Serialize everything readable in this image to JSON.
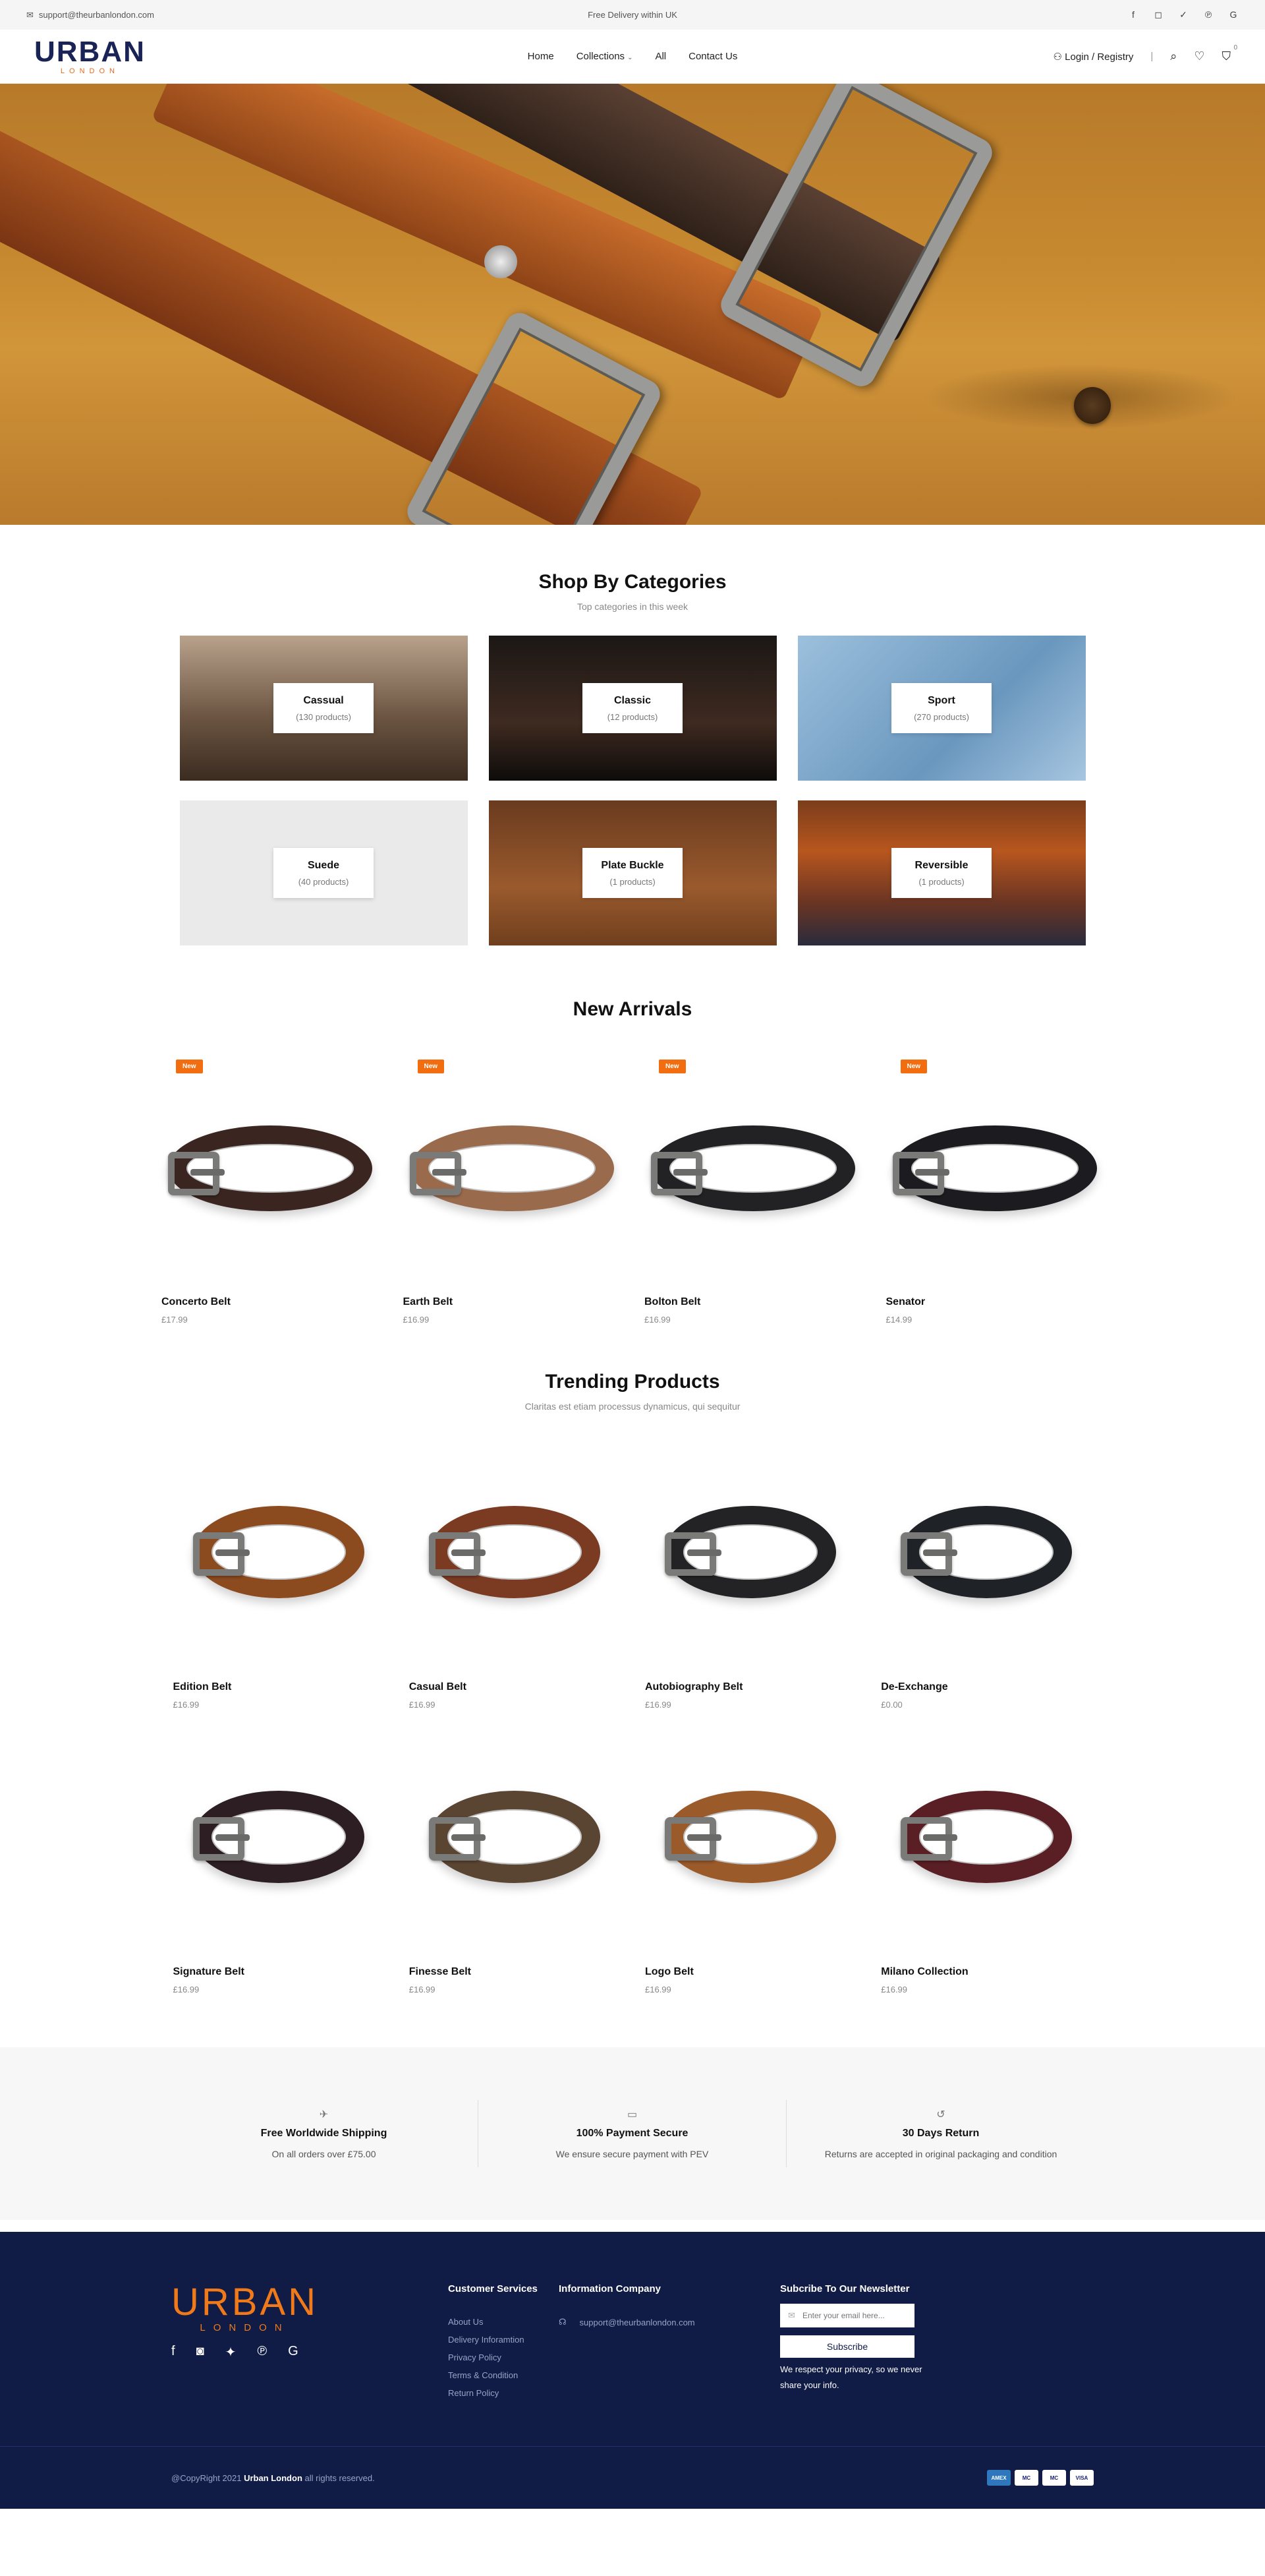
{
  "topbar": {
    "email": "support@theurbanlondon.com",
    "delivery": "Free Delivery within UK",
    "socials": [
      "facebook-icon",
      "instagram-icon",
      "twitter-icon",
      "pinterest-icon",
      "google-icon"
    ]
  },
  "header": {
    "logo_word": "URBAN",
    "logo_sub": "LONDON",
    "nav": [
      "Home",
      "Collections",
      "All",
      "Contact Us"
    ],
    "login": "Login / Registry",
    "cart_count": "0"
  },
  "categories": {
    "title": "Shop By Categories",
    "subtitle": "Top categories in this week",
    "items": [
      {
        "name": "Cassual",
        "count": "(130 products)"
      },
      {
        "name": "Classic",
        "count": "(12 products)"
      },
      {
        "name": "Sport",
        "count": "(270 products)"
      },
      {
        "name": "Suede",
        "count": "(40 products)"
      },
      {
        "name": "Plate Buckle",
        "count": "(1 products)"
      },
      {
        "name": "Reversible",
        "count": "(1 products)"
      }
    ]
  },
  "new_arrivals": {
    "title": "New Arrivals",
    "badge": "New",
    "items": [
      {
        "name": "Concerto Belt",
        "price": "£17.99",
        "color": "#3a2520"
      },
      {
        "name": "Earth Belt",
        "price": "£16.99",
        "color": "#9a6a4c"
      },
      {
        "name": "Bolton Belt",
        "price": "£16.99",
        "color": "#222225"
      },
      {
        "name": "Senator",
        "price": "£14.99",
        "color": "#1c1c20"
      }
    ]
  },
  "trending": {
    "title": "Trending Products",
    "subtitle": "Claritas est etiam processus dynamicus, qui sequitur",
    "items": [
      {
        "name": "Edition Belt",
        "price": "£16.99",
        "color": "#8c4a1f"
      },
      {
        "name": "Casual Belt",
        "price": "£16.99",
        "color": "#7a3b22"
      },
      {
        "name": "Autobiography Belt",
        "price": "£16.99",
        "color": "#232325"
      },
      {
        "name": "De-Exchange",
        "price": "£0.00",
        "color": "#1f2226"
      },
      {
        "name": "Signature Belt",
        "price": "£16.99",
        "color": "#2c1e22"
      },
      {
        "name": "Finesse Belt",
        "price": "£16.99",
        "color": "#5a4432"
      },
      {
        "name": "Logo Belt",
        "price": "£16.99",
        "color": "#9a5a2a"
      },
      {
        "name": "Milano Collection",
        "price": "£16.99",
        "color": "#5a1f24"
      }
    ]
  },
  "features": [
    {
      "title": "Free Worldwide Shipping",
      "desc": "On all orders over £75.00",
      "icon": "shipping-icon"
    },
    {
      "title": "100% Payment Secure",
      "desc": "We ensure secure payment with PEV",
      "icon": "card-icon"
    },
    {
      "title": "30 Days Return",
      "desc": "Returns are accepted in original packaging and condition",
      "icon": "return-icon"
    }
  ],
  "footer": {
    "customer_services": {
      "title": "Customer Services",
      "links": [
        "About Us",
        "Delivery Inforamtion",
        "Privacy Policy",
        "Terms & Condition",
        "Return Policy"
      ]
    },
    "information": {
      "title": "Information Company",
      "email": "support@theurbanlondon.com"
    },
    "newsletter": {
      "title": "Subcribe To Our Newsletter",
      "placeholder": "Enter your email here...",
      "button": "Subscribe",
      "note": "We respect your privacy, so we never share your info."
    },
    "copyright_prefix": "@CopyRight 2021",
    "copyright_brand": "Urban London",
    "copyright_suffix": "all rights reserved.",
    "payments": [
      "AMEX",
      "MC",
      "MC",
      "VISA"
    ]
  }
}
